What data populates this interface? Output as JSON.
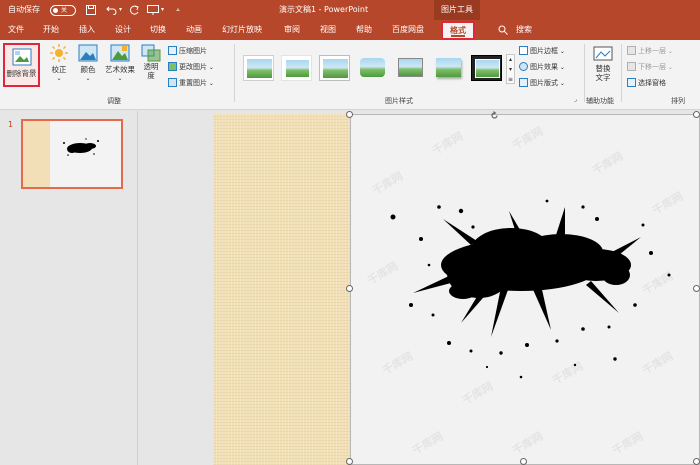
{
  "titlebar": {
    "autosave_label": "自动保存",
    "autosave_state": "关",
    "doc_title": "演示文稿1 - PowerPoint",
    "context_tab": "图片工具"
  },
  "menu": {
    "tabs": [
      "文件",
      "开始",
      "插入",
      "设计",
      "切换",
      "动画",
      "幻灯片放映",
      "审阅",
      "视图",
      "帮助",
      "百度网盘"
    ],
    "active_tab": "格式",
    "search_label": "搜索"
  },
  "ribbon": {
    "remove_bg": "删除背景",
    "correct": "校正",
    "color": "颜色",
    "artistic": "艺术效果",
    "transparency_1": "透明",
    "transparency_2": "度",
    "compress": "压缩图片",
    "change": "更改图片",
    "reset": "重置图片",
    "group_adjust": "调整",
    "group_styles": "图片样式",
    "border": "图片边框",
    "effects": "图片效果",
    "layout": "图片版式",
    "alt_text_1": "替换",
    "alt_text_2": "文字",
    "group_accessibility": "辅助功能",
    "bring_forward": "上移一层",
    "send_backward": "下移一层",
    "selection_pane": "选择窗格",
    "group_arrange": "排列"
  },
  "slides": {
    "thumb_number": "1"
  },
  "canvas": {
    "watermark": "千库网"
  },
  "colors": {
    "accent": "#b7472a",
    "highlight": "#e0263a",
    "slide_bg": "#f1dfb6"
  }
}
